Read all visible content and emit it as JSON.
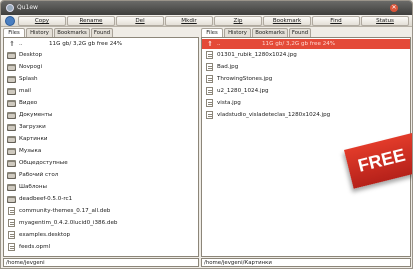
{
  "window": {
    "title": "Qu1ew"
  },
  "toolbar": {
    "buttons": [
      {
        "label": "Copy"
      },
      {
        "label": "Rename"
      },
      {
        "label": "Del"
      },
      {
        "label": "Mkdir"
      },
      {
        "label": "Zip"
      },
      {
        "label": "Bookmark"
      },
      {
        "label": "Find"
      },
      {
        "label": "Status"
      }
    ]
  },
  "left_panel": {
    "tabs": [
      "Files",
      "History",
      "Bookmarks",
      "Found"
    ],
    "active_tab": "Files",
    "header": {
      "name": "..",
      "info": "11G gb/ 3,2G gb free 24%"
    },
    "items": [
      {
        "name": "Desktop",
        "type": "folder"
      },
      {
        "name": "Novpogi",
        "type": "folder"
      },
      {
        "name": "Splash",
        "type": "folder"
      },
      {
        "name": "mail",
        "type": "folder"
      },
      {
        "name": "Видео",
        "type": "folder"
      },
      {
        "name": "Документы",
        "type": "folder"
      },
      {
        "name": "Загрузки",
        "type": "folder"
      },
      {
        "name": "Картинки",
        "type": "folder"
      },
      {
        "name": "Музыка",
        "type": "folder"
      },
      {
        "name": "Общедоступные",
        "type": "folder"
      },
      {
        "name": "Рабочий стол",
        "type": "folder"
      },
      {
        "name": "Шаблоны",
        "type": "folder"
      },
      {
        "name": "deadbeef-0.5.0-rc1",
        "type": "folder"
      },
      {
        "name": "community-themes_0.17_all.deb",
        "type": "file"
      },
      {
        "name": "myagentim_0.4.2.0lucid0_i386.deb",
        "type": "file"
      },
      {
        "name": "examples.desktop",
        "type": "file"
      },
      {
        "name": "feeds.opml",
        "type": "file"
      }
    ],
    "path": "/home/jevgeni"
  },
  "right_panel": {
    "tabs": [
      "Files",
      "History",
      "Bookmarks",
      "Found"
    ],
    "active_tab": "Files",
    "header": {
      "name": "..",
      "info": "11G gb/ 3,2G gb free 24%"
    },
    "items": [
      {
        "name": "01301_rubik_1280x1024.jpg",
        "type": "file"
      },
      {
        "name": "Bad.jpg",
        "type": "file"
      },
      {
        "name": "ThrowingStones.jpg",
        "type": "file"
      },
      {
        "name": "u2_1280_1024.jpg",
        "type": "file"
      },
      {
        "name": "vista.jpg",
        "type": "file"
      },
      {
        "name": "vladstudio_visladeteclas_1280x1024.jpg",
        "type": "file"
      }
    ],
    "path": "/home/jevgeni/Картинки"
  },
  "badge": {
    "text": "FREE"
  }
}
